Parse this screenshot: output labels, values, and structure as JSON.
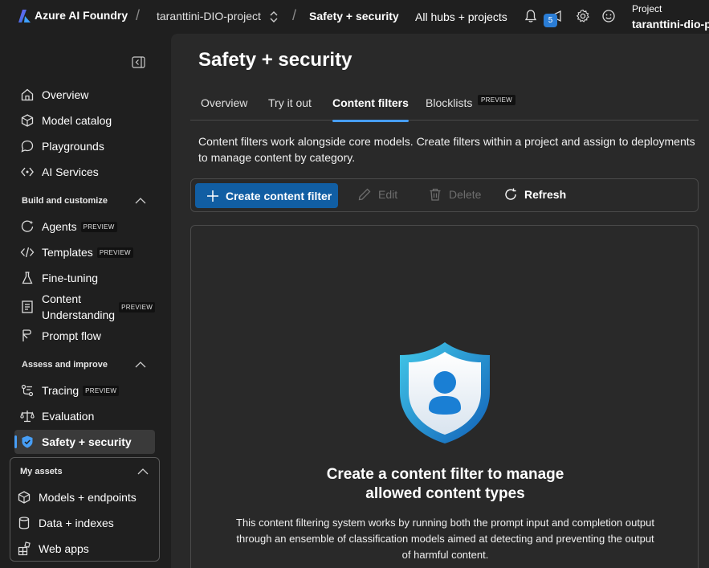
{
  "topbar": {
    "brand": "Azure AI Foundry",
    "project_crumb": "taranttini-DIO-project",
    "current_crumb": "Safety + security",
    "hubs_link": "All hubs + projects",
    "notification_count": "5",
    "project_label": "Project",
    "project_name": "taranttini-dio-p"
  },
  "sidebar": {
    "top_items": [
      {
        "label": "Overview",
        "icon": "home-icon"
      },
      {
        "label": "Model catalog",
        "icon": "cube-icon"
      },
      {
        "label": "Playgrounds",
        "icon": "chat-icon"
      },
      {
        "label": "AI Services",
        "icon": "ai-services-icon"
      }
    ],
    "build_section": "Build and customize",
    "build_items": [
      {
        "label": "Agents",
        "badge": "PREVIEW",
        "icon": "agents-icon"
      },
      {
        "label": "Templates",
        "badge": "PREVIEW",
        "icon": "code-icon"
      },
      {
        "label": "Fine-tuning",
        "icon": "flask-icon"
      },
      {
        "label": "Content Understanding",
        "badge": "PREVIEW",
        "icon": "document-icon"
      },
      {
        "label": "Prompt flow",
        "icon": "flow-icon"
      }
    ],
    "assess_section": "Assess and improve",
    "assess_items": [
      {
        "label": "Tracing",
        "badge": "PREVIEW",
        "icon": "tracing-icon"
      },
      {
        "label": "Evaluation",
        "icon": "scale-icon"
      },
      {
        "label": "Safety + security",
        "icon": "shield-icon",
        "active": true
      }
    ],
    "assets_section": "My assets",
    "assets_items": [
      {
        "label": "Models + endpoints",
        "icon": "box-icon"
      },
      {
        "label": "Data + indexes",
        "icon": "database-icon"
      },
      {
        "label": "Web apps",
        "icon": "apps-icon"
      }
    ]
  },
  "main": {
    "title": "Safety + security",
    "tabs": [
      {
        "label": "Overview"
      },
      {
        "label": "Try it out"
      },
      {
        "label": "Content filters",
        "active": true
      },
      {
        "label": "Blocklists",
        "badge": "PREVIEW"
      }
    ],
    "description": "Content filters work alongside core models. Create filters within a project and assign to deployments to manage content by category.",
    "toolbar": {
      "create": "Create content filter",
      "edit": "Edit",
      "delete": "Delete",
      "refresh": "Refresh"
    },
    "empty_state": {
      "title_line1": "Create a content filter to manage",
      "title_line2": "allowed content types",
      "description": "This content filtering system works by running both the prompt input and completion output through an ensemble of classification models aimed at detecting and preventing the output of harmful content."
    }
  },
  "colors": {
    "accent": "#479ef5",
    "primary_button": "#115ea3",
    "background": "#1f1f1f",
    "panel": "#292929"
  }
}
